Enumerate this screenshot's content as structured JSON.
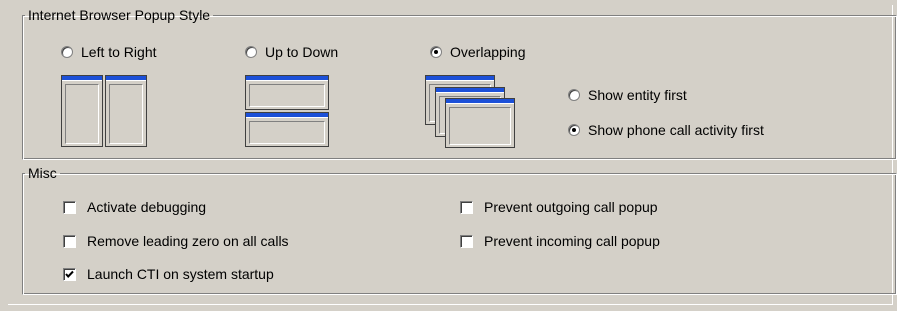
{
  "browser_popup_style": {
    "title": "Internet Browser Popup Style",
    "options": [
      {
        "label": "Left to Right",
        "selected": false
      },
      {
        "label": "Up to Down",
        "selected": false
      },
      {
        "label": "Overlapping",
        "selected": true
      }
    ],
    "overlap_order": [
      {
        "label": "Show entity first",
        "selected": false
      },
      {
        "label": "Show phone call activity first",
        "selected": true
      }
    ]
  },
  "misc": {
    "title": "Misc",
    "checkboxes": [
      {
        "label": "Activate debugging",
        "checked": false
      },
      {
        "label": "Remove leading zero on all calls",
        "checked": false
      },
      {
        "label": "Launch CTI on system startup",
        "checked": true
      },
      {
        "label": "Prevent outgoing call popup",
        "checked": false
      },
      {
        "label": "Prevent incoming call popup",
        "checked": false
      }
    ]
  },
  "colors": {
    "face": "#d4d0c8",
    "titlebar": "#1c50d8"
  },
  "icons": [
    "left-to-right-layout-icon",
    "up-to-down-layout-icon",
    "overlapping-layout-icon"
  ]
}
